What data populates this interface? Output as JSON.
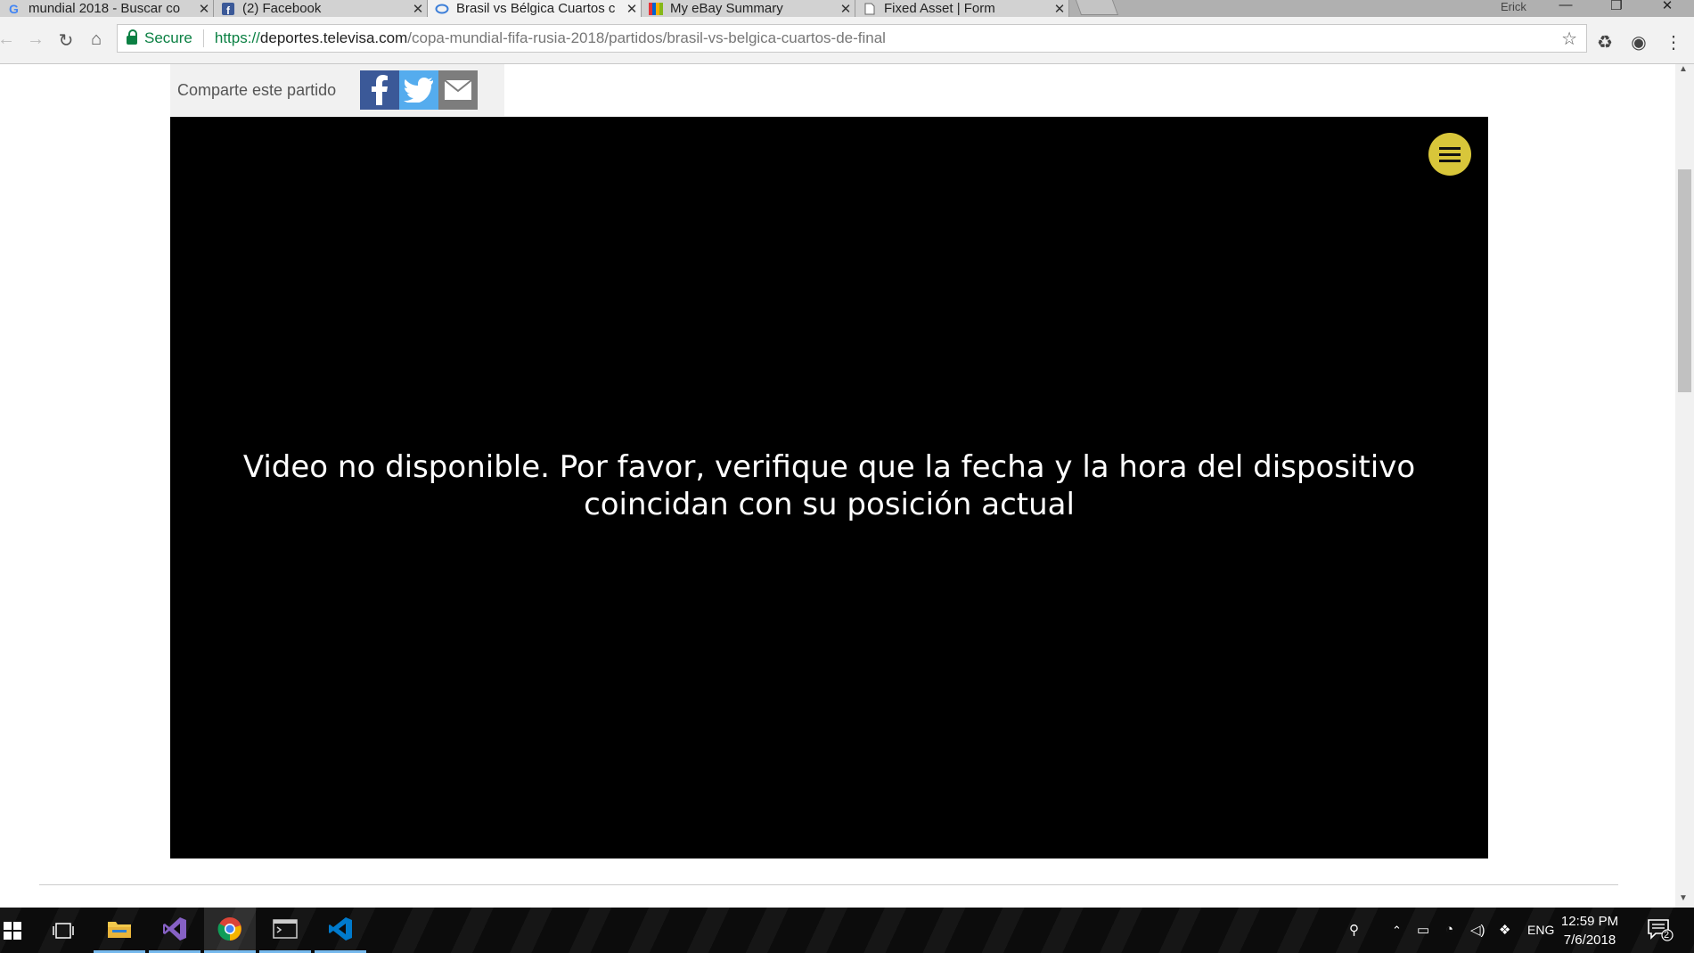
{
  "tabs": [
    {
      "title": "mundial 2018 - Buscar co",
      "icon": "google-icon",
      "active": false
    },
    {
      "title": "(2) Facebook",
      "icon": "facebook-icon",
      "active": false
    },
    {
      "title": "Brasil vs Bélgica Cuartos c",
      "icon": "loading-icon",
      "active": true
    },
    {
      "title": "My eBay Summary",
      "icon": "ebay-icon",
      "active": false
    },
    {
      "title": "Fixed Asset | Form",
      "icon": "document-icon",
      "active": false
    }
  ],
  "window": {
    "user": "Erick"
  },
  "toolbar": {
    "secure_label": "Secure",
    "url_scheme": "https://",
    "url_host": "deportes.televisa.com",
    "url_path": "/copa-mundial-fifa-rusia-2018/partidos/brasil-vs-belgica-cuartos-de-final"
  },
  "share": {
    "label": "Comparte este partido"
  },
  "player": {
    "message": "Video no disponible. Por favor, verifique que la fecha y la hora del dispositivo coincidan con su posición actual",
    "menu_color": "#d8c63a"
  },
  "taskbar": {
    "apps": [
      "start-icon",
      "task-view-icon",
      "file-explorer-icon",
      "visual-studio-icon",
      "chrome-icon",
      "terminal-icon",
      "vscode-icon"
    ],
    "language": "ENG",
    "time": "12:59 PM",
    "date": "7/6/2018",
    "notifications": "2"
  },
  "colors": {
    "secure": "#0b8043",
    "facebook": "#3b5998",
    "twitter": "#55acee",
    "taskbar_accent": "#76b9ed"
  }
}
